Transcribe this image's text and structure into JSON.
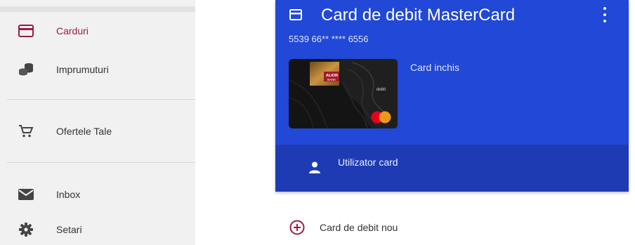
{
  "sidebar": {
    "items": [
      {
        "label": "Carduri",
        "icon": "credit-card-icon",
        "active": true
      },
      {
        "label": "Imprumuturi",
        "icon": "coins-icon",
        "active": false
      },
      {
        "label": "Ofertele Tale",
        "icon": "cart-icon",
        "active": false
      },
      {
        "label": "Inbox",
        "icon": "envelope-icon",
        "active": false
      },
      {
        "label": "Setari",
        "icon": "gear-icon",
        "active": false
      }
    ]
  },
  "card_panel": {
    "title": "Card de debit MasterCard",
    "number": "5539 66** **** 6556",
    "status": "Card inchis",
    "card_image": {
      "bank_name": "ALIOR",
      "bank_sub": "BANK",
      "card_type": "debit"
    },
    "user_label": "Utilizator card"
  },
  "new_card": {
    "label": "Card de debit nou"
  },
  "colors": {
    "accent": "#9b1b4a",
    "panel_blue": "#2148d6",
    "panel_dark_blue": "#1f3bb3",
    "sidebar_bg": "#f1f1f1"
  }
}
